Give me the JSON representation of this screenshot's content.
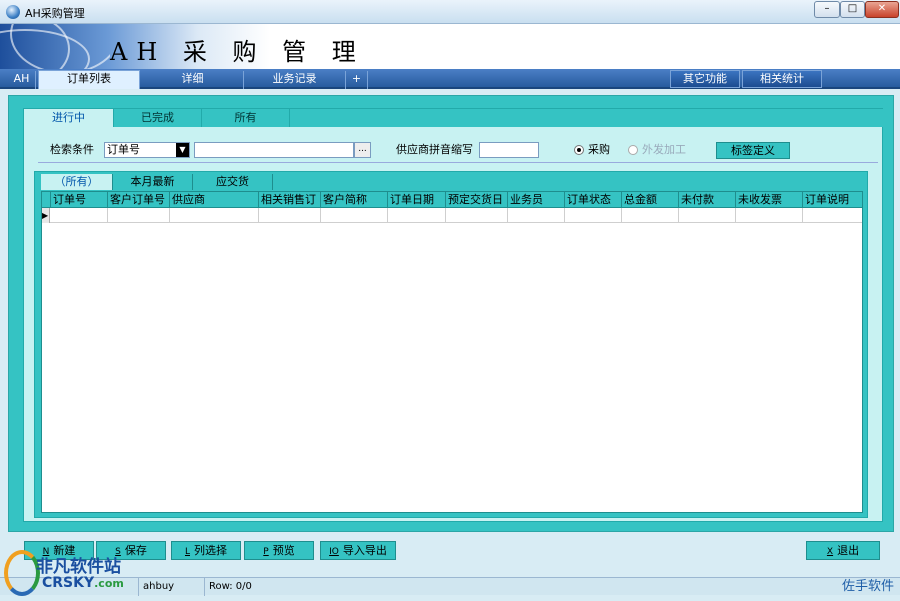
{
  "window": {
    "title": "AH采购管理",
    "min": "–",
    "max": "□",
    "close": "✕"
  },
  "banner": {
    "title": "AH 采 购 管 理"
  },
  "top_tabs": [
    "AH",
    "订单列表",
    "详细",
    "业务记录",
    "+"
  ],
  "top_right_buttons": [
    "其它功能",
    "相关统计"
  ],
  "sub_tabs": [
    "进行中",
    "已完成",
    "所有"
  ],
  "search": {
    "label": "检索条件",
    "field_value": "订单号",
    "dots_label": "...",
    "supplier_label": "供应商拼音缩写",
    "radio_purchase": "采购",
    "radio_outsource": "外发加工",
    "tag_button": "标签定义"
  },
  "grid_tabs": [
    "（所有）",
    "本月最新",
    "应交货"
  ],
  "columns": [
    "订单号",
    "客户订单号",
    "供应商",
    "相关销售订",
    "客户简称",
    "订单日期",
    "预定交货日",
    "业务员",
    "订单状态",
    "总金额",
    "未付款",
    "未收发票",
    "订单说明"
  ],
  "bottom_buttons": [
    {
      "key": "N",
      "label": "新建"
    },
    {
      "key": "S",
      "label": "保存"
    },
    {
      "key": "L",
      "label": "列选择"
    },
    {
      "key": "P",
      "label": "预览"
    },
    {
      "key": "IO",
      "label": "导入导出"
    },
    {
      "key": "X",
      "label": "退出"
    }
  ],
  "status": {
    "user": "ahbuy",
    "row": "Row: 0/0",
    "brand": "佐手软件"
  },
  "watermark": {
    "cn": "非凡软件站",
    "en": "CRSKY",
    "suffix": ".com"
  },
  "colors": {
    "accent": "#35c3c3",
    "panel": "#c8f2f2",
    "topbar": "#285c9e"
  }
}
